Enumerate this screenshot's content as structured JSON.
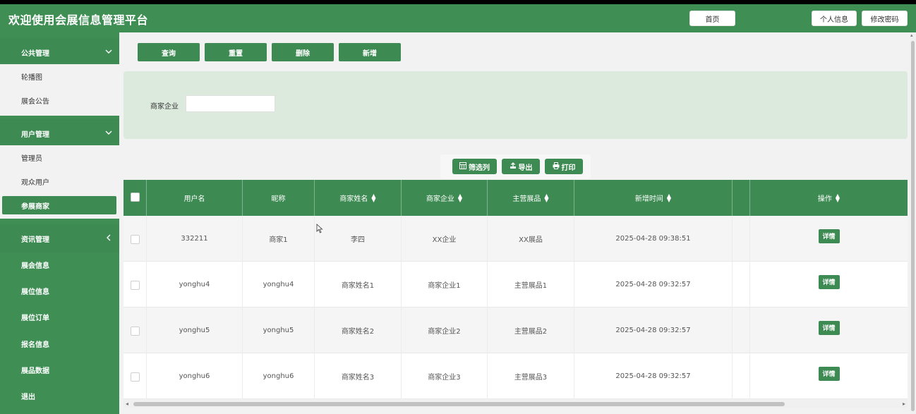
{
  "header": {
    "title": "欢迎使用会展信息管理平台",
    "home": "首页",
    "profile": "个人信息",
    "change_password": "修改密码"
  },
  "sidebar": {
    "groups": [
      {
        "label": "公共管理",
        "items": [
          "轮播图",
          "展会公告"
        ]
      },
      {
        "label": "用户管理",
        "items": [
          "管理员",
          "观众用户",
          "参展商家"
        ]
      },
      {
        "label": "资讯管理"
      }
    ],
    "active_item": "参展商家",
    "nav_items": [
      "展会信息",
      "展位信息",
      "展位订单",
      "报名信息",
      "展品数据",
      "退出"
    ]
  },
  "actions": {
    "query": "查询",
    "reset": "重置",
    "delete": "删除",
    "add": "新增"
  },
  "search": {
    "label": "商家企业",
    "value": ""
  },
  "toolbar": {
    "columns": "筛选列",
    "export": "导出",
    "print": "打印"
  },
  "table": {
    "headers": [
      "用户名",
      "昵称",
      "商家姓名",
      "商家企业",
      "主营展品",
      "新增时间",
      "",
      "操作"
    ],
    "detail_label": "详情",
    "rows": [
      [
        "332211",
        "商家1",
        "李四",
        "XX企业",
        "XX展品",
        "2025-04-28 09:38:51"
      ],
      [
        "yonghu4",
        "yonghu4",
        "商家姓名1",
        "商家企业1",
        "主营展品1",
        "2025-04-28 09:32:57"
      ],
      [
        "yonghu5",
        "yonghu5",
        "商家姓名2",
        "商家企业2",
        "主营展品2",
        "2025-04-28 09:32:57"
      ],
      [
        "yonghu6",
        "yonghu6",
        "商家姓名3",
        "商家企业3",
        "主营展品3",
        "2025-04-28 09:32:57"
      ]
    ]
  },
  "colors": {
    "primary": "#3d8b52",
    "header_bg": "#3f8f55",
    "panel_bg": "#dceade"
  }
}
